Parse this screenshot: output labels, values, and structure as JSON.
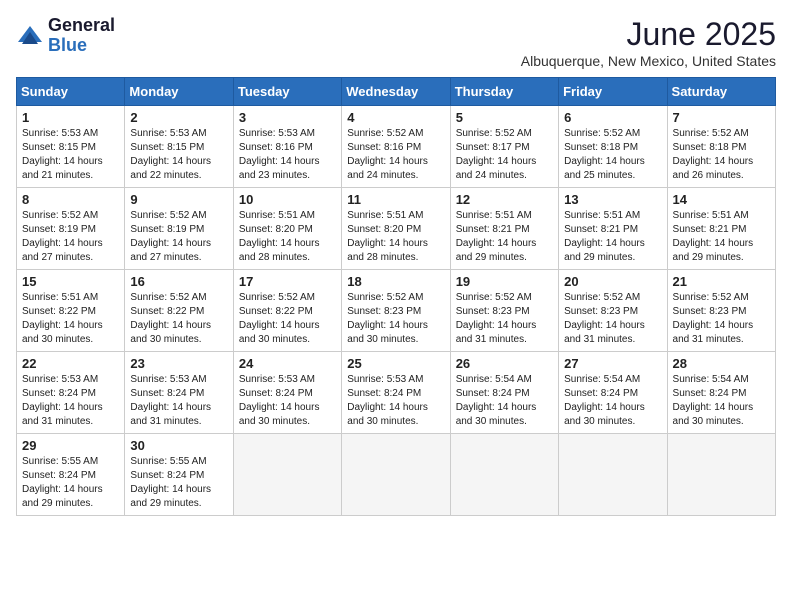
{
  "header": {
    "logo_general": "General",
    "logo_blue": "Blue",
    "month_title": "June 2025",
    "location": "Albuquerque, New Mexico, United States"
  },
  "columns": [
    "Sunday",
    "Monday",
    "Tuesday",
    "Wednesday",
    "Thursday",
    "Friday",
    "Saturday"
  ],
  "weeks": [
    [
      {
        "day": "1",
        "info": "Sunrise: 5:53 AM\nSunset: 8:15 PM\nDaylight: 14 hours\nand 21 minutes."
      },
      {
        "day": "2",
        "info": "Sunrise: 5:53 AM\nSunset: 8:15 PM\nDaylight: 14 hours\nand 22 minutes."
      },
      {
        "day": "3",
        "info": "Sunrise: 5:53 AM\nSunset: 8:16 PM\nDaylight: 14 hours\nand 23 minutes."
      },
      {
        "day": "4",
        "info": "Sunrise: 5:52 AM\nSunset: 8:16 PM\nDaylight: 14 hours\nand 24 minutes."
      },
      {
        "day": "5",
        "info": "Sunrise: 5:52 AM\nSunset: 8:17 PM\nDaylight: 14 hours\nand 24 minutes."
      },
      {
        "day": "6",
        "info": "Sunrise: 5:52 AM\nSunset: 8:18 PM\nDaylight: 14 hours\nand 25 minutes."
      },
      {
        "day": "7",
        "info": "Sunrise: 5:52 AM\nSunset: 8:18 PM\nDaylight: 14 hours\nand 26 minutes."
      }
    ],
    [
      {
        "day": "8",
        "info": "Sunrise: 5:52 AM\nSunset: 8:19 PM\nDaylight: 14 hours\nand 27 minutes."
      },
      {
        "day": "9",
        "info": "Sunrise: 5:52 AM\nSunset: 8:19 PM\nDaylight: 14 hours\nand 27 minutes."
      },
      {
        "day": "10",
        "info": "Sunrise: 5:51 AM\nSunset: 8:20 PM\nDaylight: 14 hours\nand 28 minutes."
      },
      {
        "day": "11",
        "info": "Sunrise: 5:51 AM\nSunset: 8:20 PM\nDaylight: 14 hours\nand 28 minutes."
      },
      {
        "day": "12",
        "info": "Sunrise: 5:51 AM\nSunset: 8:21 PM\nDaylight: 14 hours\nand 29 minutes."
      },
      {
        "day": "13",
        "info": "Sunrise: 5:51 AM\nSunset: 8:21 PM\nDaylight: 14 hours\nand 29 minutes."
      },
      {
        "day": "14",
        "info": "Sunrise: 5:51 AM\nSunset: 8:21 PM\nDaylight: 14 hours\nand 29 minutes."
      }
    ],
    [
      {
        "day": "15",
        "info": "Sunrise: 5:51 AM\nSunset: 8:22 PM\nDaylight: 14 hours\nand 30 minutes."
      },
      {
        "day": "16",
        "info": "Sunrise: 5:52 AM\nSunset: 8:22 PM\nDaylight: 14 hours\nand 30 minutes."
      },
      {
        "day": "17",
        "info": "Sunrise: 5:52 AM\nSunset: 8:22 PM\nDaylight: 14 hours\nand 30 minutes."
      },
      {
        "day": "18",
        "info": "Sunrise: 5:52 AM\nSunset: 8:23 PM\nDaylight: 14 hours\nand 30 minutes."
      },
      {
        "day": "19",
        "info": "Sunrise: 5:52 AM\nSunset: 8:23 PM\nDaylight: 14 hours\nand 31 minutes."
      },
      {
        "day": "20",
        "info": "Sunrise: 5:52 AM\nSunset: 8:23 PM\nDaylight: 14 hours\nand 31 minutes."
      },
      {
        "day": "21",
        "info": "Sunrise: 5:52 AM\nSunset: 8:23 PM\nDaylight: 14 hours\nand 31 minutes."
      }
    ],
    [
      {
        "day": "22",
        "info": "Sunrise: 5:53 AM\nSunset: 8:24 PM\nDaylight: 14 hours\nand 31 minutes."
      },
      {
        "day": "23",
        "info": "Sunrise: 5:53 AM\nSunset: 8:24 PM\nDaylight: 14 hours\nand 31 minutes."
      },
      {
        "day": "24",
        "info": "Sunrise: 5:53 AM\nSunset: 8:24 PM\nDaylight: 14 hours\nand 30 minutes."
      },
      {
        "day": "25",
        "info": "Sunrise: 5:53 AM\nSunset: 8:24 PM\nDaylight: 14 hours\nand 30 minutes."
      },
      {
        "day": "26",
        "info": "Sunrise: 5:54 AM\nSunset: 8:24 PM\nDaylight: 14 hours\nand 30 minutes."
      },
      {
        "day": "27",
        "info": "Sunrise: 5:54 AM\nSunset: 8:24 PM\nDaylight: 14 hours\nand 30 minutes."
      },
      {
        "day": "28",
        "info": "Sunrise: 5:54 AM\nSunset: 8:24 PM\nDaylight: 14 hours\nand 30 minutes."
      }
    ],
    [
      {
        "day": "29",
        "info": "Sunrise: 5:55 AM\nSunset: 8:24 PM\nDaylight: 14 hours\nand 29 minutes."
      },
      {
        "day": "30",
        "info": "Sunrise: 5:55 AM\nSunset: 8:24 PM\nDaylight: 14 hours\nand 29 minutes."
      },
      {
        "day": "",
        "info": ""
      },
      {
        "day": "",
        "info": ""
      },
      {
        "day": "",
        "info": ""
      },
      {
        "day": "",
        "info": ""
      },
      {
        "day": "",
        "info": ""
      }
    ]
  ]
}
